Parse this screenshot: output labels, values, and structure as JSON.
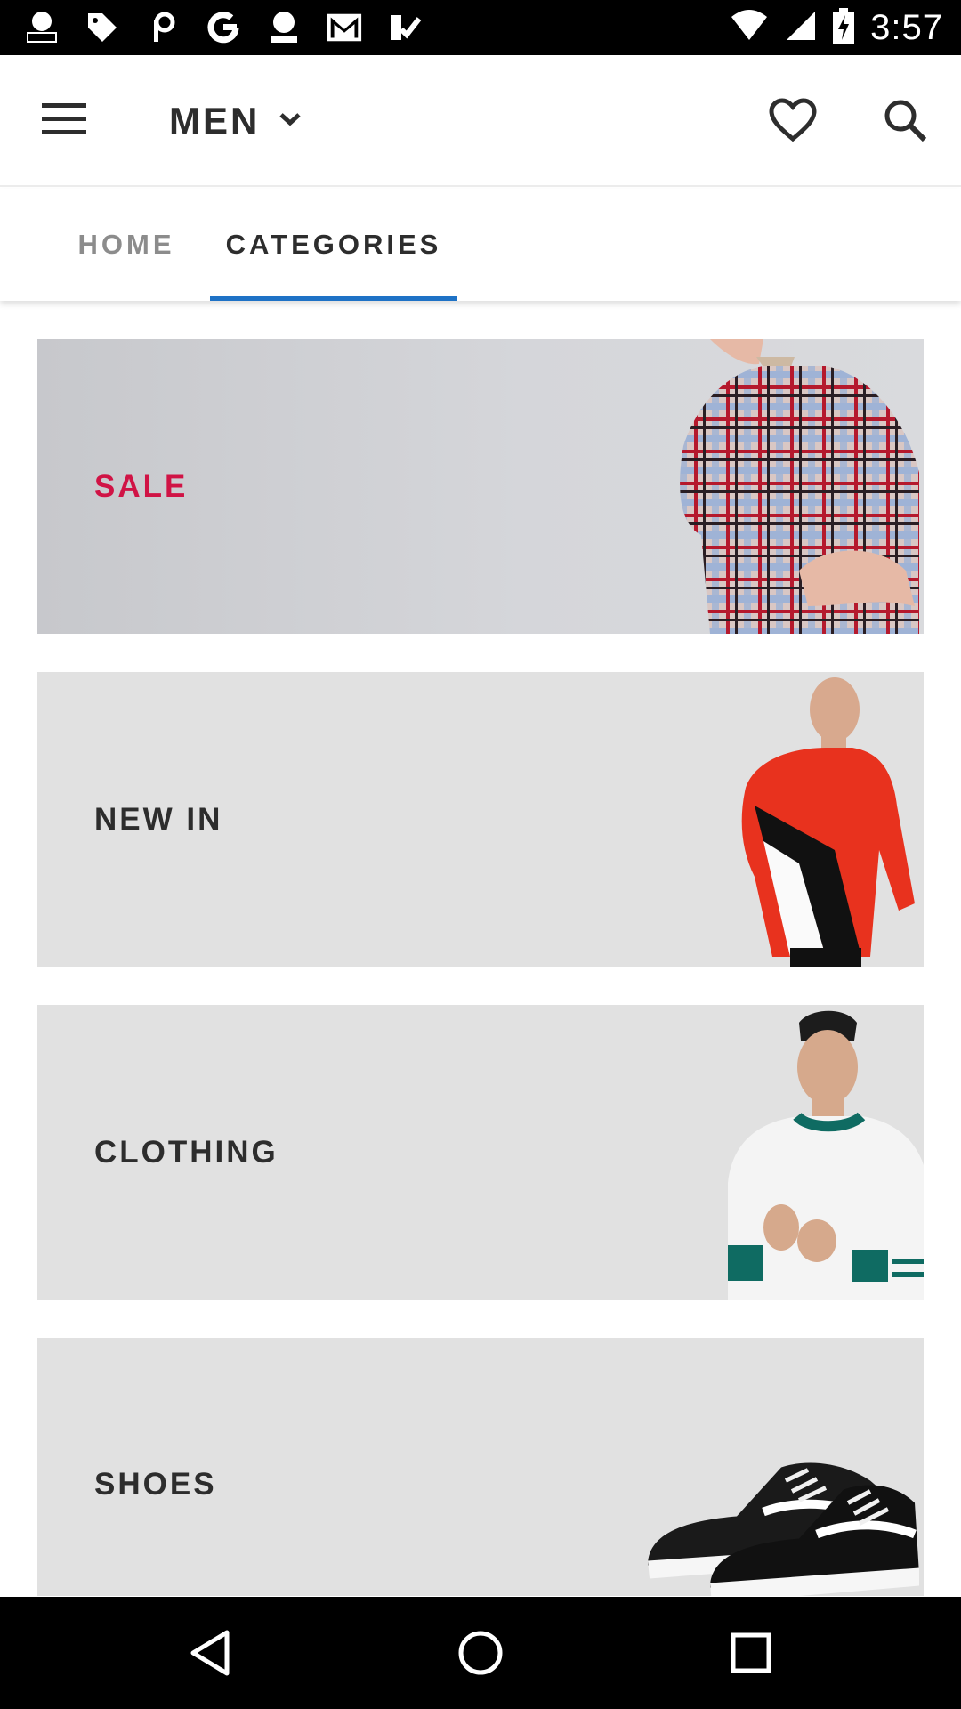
{
  "status_bar": {
    "time": "3:57",
    "notification_icons": [
      "nbc-news-icon",
      "tag-icon",
      "picsart-icon",
      "google-icon",
      "abc-news-icon",
      "gmail-icon",
      "check-app-icon"
    ],
    "system_icons": [
      "wifi-icon",
      "cell-signal-icon",
      "battery-charging-icon"
    ]
  },
  "header": {
    "gender": "MEN",
    "menu_icon": "hamburger-icon",
    "heart_icon": "heart-outline-icon",
    "search_icon": "search-icon"
  },
  "tabs": [
    {
      "label": "HOME",
      "active": false
    },
    {
      "label": "CATEGORIES",
      "active": true
    }
  ],
  "categories": [
    {
      "label": "SALE",
      "color": "#d01345"
    },
    {
      "label": "NEW IN",
      "color": "#2d2d2d"
    },
    {
      "label": "CLOTHING",
      "color": "#2d2d2d"
    },
    {
      "label": "SHOES",
      "color": "#2d2d2d"
    }
  ],
  "colors": {
    "accent_blue": "#1e72c6",
    "sale_red": "#d01345",
    "text_dark": "#2d2d2d",
    "tab_inactive": "#8c8c8c"
  }
}
